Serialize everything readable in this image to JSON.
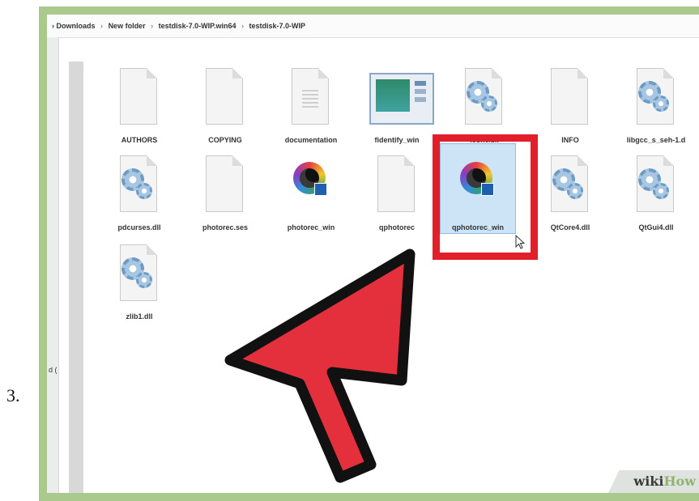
{
  "step": {
    "number": "3."
  },
  "address_bar": {
    "crumbs": [
      "Downloads",
      "New folder",
      "testdisk-7.0-WIP.win64",
      "testdisk-7.0-WIP"
    ],
    "separator": "›"
  },
  "left_pane": {
    "fragment": "d ("
  },
  "files": [
    {
      "label": "AUTHORS",
      "icon": "blank-document-icon"
    },
    {
      "label": "COPYING",
      "icon": "blank-document-icon"
    },
    {
      "label": "documentation",
      "icon": "text-document-icon"
    },
    {
      "label": "fidentify_win",
      "icon": "application-thumbnail-icon"
    },
    {
      "label": "iconv.dll",
      "icon": "dll-gear-icon"
    },
    {
      "label": "INFO",
      "icon": "blank-document-icon"
    },
    {
      "label": "libgcc_s_seh-1.d",
      "icon": "dll-gear-icon"
    },
    {
      "label": "pdcurses.dll",
      "icon": "dll-gear-icon"
    },
    {
      "label": "photorec.ses",
      "icon": "blank-document-icon"
    },
    {
      "label": "photorec_win",
      "icon": "photorec-app-icon"
    },
    {
      "label": "qphotorec",
      "icon": "blank-document-icon"
    },
    {
      "label": "qphotorec_win",
      "icon": "photorec-app-icon",
      "selected": true
    },
    {
      "label": "QtCore4.dll",
      "icon": "dll-gear-icon"
    },
    {
      "label": "QtGui4.dll",
      "icon": "dll-gear-icon"
    },
    {
      "label": "zlib1.dll",
      "icon": "dll-gear-icon"
    }
  ],
  "colors": {
    "highlight": "#e01f2b",
    "arrow": "#e4303c",
    "frame": "#a9c98d",
    "selection": "#cde4f7"
  },
  "watermark": {
    "wiki": "wiki",
    "how": "How"
  }
}
